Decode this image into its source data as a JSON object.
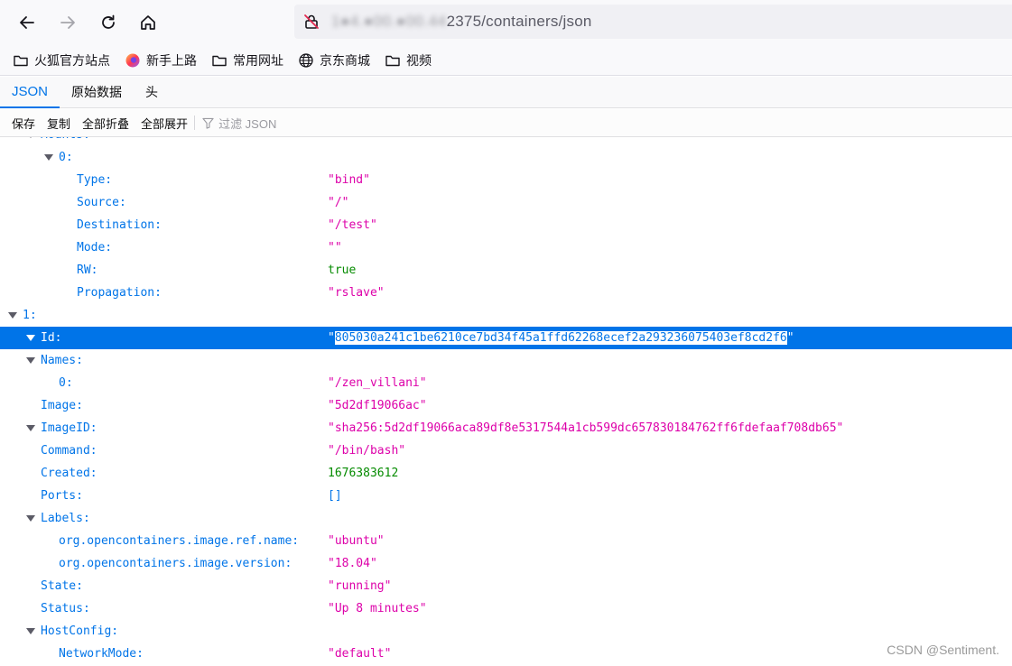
{
  "browser": {
    "url_host": "1●4.●00.●00.44",
    "url_path": "2375/containers/json",
    "bookmarks": [
      {
        "label": "火狐官方站点",
        "icon": "folder-icon"
      },
      {
        "label": "新手上路",
        "icon": "firefox-icon"
      },
      {
        "label": "常用网址",
        "icon": "folder-icon"
      },
      {
        "label": "京东商城",
        "icon": "globe-icon"
      },
      {
        "label": "视频",
        "icon": "folder-icon"
      }
    ]
  },
  "viewer": {
    "tabs": [
      {
        "label": "JSON",
        "active": true
      },
      {
        "label": "原始数据",
        "active": false
      },
      {
        "label": "头",
        "active": false
      }
    ],
    "toolbar": {
      "save": "保存",
      "copy": "复制",
      "collapse_all": "全部折叠",
      "expand_all": "全部展开",
      "filter_placeholder": "过滤 JSON"
    }
  },
  "tree": [
    {
      "key": "Mounts:",
      "depth": 2,
      "expanded": true,
      "value": "",
      "type": "none"
    },
    {
      "key": "0:",
      "depth": 3,
      "expanded": true,
      "value": "",
      "type": "none"
    },
    {
      "key": "Type:",
      "depth": 4,
      "value": "\"bind\"",
      "type": "string"
    },
    {
      "key": "Source:",
      "depth": 4,
      "value": "\"/\"",
      "type": "string"
    },
    {
      "key": "Destination:",
      "depth": 4,
      "value": "\"/test\"",
      "type": "string"
    },
    {
      "key": "Mode:",
      "depth": 4,
      "value": "\"\"",
      "type": "string"
    },
    {
      "key": "RW:",
      "depth": 4,
      "value": "true",
      "type": "bool"
    },
    {
      "key": "Propagation:",
      "depth": 4,
      "value": "\"rslave\"",
      "type": "string"
    },
    {
      "key": "1:",
      "depth": 0,
      "expanded": true,
      "value": "",
      "type": "none"
    },
    {
      "key": "Id:",
      "depth": 2,
      "expanded": true,
      "selected": true,
      "value": "805030a241c1be6210ce7bd34f45a1ffd62268ecef2a293236075403ef8cd2f6",
      "type": "string"
    },
    {
      "key": "Names:",
      "depth": 2,
      "expanded": true,
      "value": "",
      "type": "none"
    },
    {
      "key": "0:",
      "depth": 3,
      "value": "\"/zen_villani\"",
      "type": "string"
    },
    {
      "key": "Image:",
      "depth": 2,
      "value": "\"5d2df19066ac\"",
      "type": "string"
    },
    {
      "key": "ImageID:",
      "depth": 2,
      "expanded": true,
      "value": "\"sha256:5d2df19066aca89df8e5317544a1cb599dc657830184762ff6fdefaaf708db65\"",
      "type": "string"
    },
    {
      "key": "Command:",
      "depth": 2,
      "value": "\"/bin/bash\"",
      "type": "string"
    },
    {
      "key": "Created:",
      "depth": 2,
      "value": "1676383612",
      "type": "number"
    },
    {
      "key": "Ports:",
      "depth": 2,
      "value": "[]",
      "type": "array"
    },
    {
      "key": "Labels:",
      "depth": 2,
      "expanded": true,
      "value": "",
      "type": "none"
    },
    {
      "key": "org.opencontainers.image.ref.name:",
      "depth": 3,
      "value": "\"ubuntu\"",
      "type": "string"
    },
    {
      "key": "org.opencontainers.image.version:",
      "depth": 3,
      "value": "\"18.04\"",
      "type": "string"
    },
    {
      "key": "State:",
      "depth": 2,
      "value": "\"running\"",
      "type": "string"
    },
    {
      "key": "Status:",
      "depth": 2,
      "value": "\"Up 8 minutes\"",
      "type": "string"
    },
    {
      "key": "HostConfig:",
      "depth": 2,
      "expanded": true,
      "value": "",
      "type": "none"
    },
    {
      "key": "NetworkMode:",
      "depth": 3,
      "value": "\"default\"",
      "type": "string"
    }
  ],
  "watermark": "CSDN @Sentiment."
}
